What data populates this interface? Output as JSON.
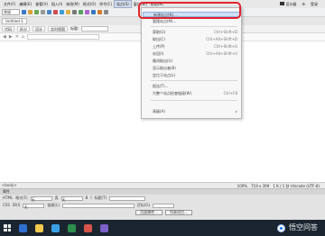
{
  "menubar": {
    "items": [
      "文件(F)",
      "编辑(E)",
      "查看(V)",
      "插入(I)",
      "修改(M)",
      "格式(O)",
      "命令(C)",
      "站点(S)",
      "窗口(W)",
      "帮助(H)"
    ],
    "right": [
      "设计器",
      "⚙",
      "登录"
    ]
  },
  "toolbar": {
    "style_select": "常规"
  },
  "document": {
    "tab": "Untitled-1"
  },
  "viewbar": {
    "buttons": [
      "代码",
      "拆分",
      "设计",
      "实时视图"
    ],
    "title_label": "标题:"
  },
  "site_menu": {
    "items": [
      {
        "label": "新建站点(N)...",
        "shortcut": ""
      },
      {
        "label": "管理站点(M)...",
        "shortcut": ""
      },
      {
        "label": "获取(G)",
        "shortcut": "Ctrl+Shift+D"
      },
      {
        "label": "取出(C)",
        "shortcut": "Ctrl+Alt+Shift+D"
      },
      {
        "label": "上传(P)",
        "shortcut": "Ctrl+Shift+U"
      },
      {
        "label": "存回(I)",
        "shortcut": "Ctrl+Alt+Shift+U"
      },
      {
        "label": "撤消取出(U)",
        "shortcut": ""
      },
      {
        "label": "显示取出者(B)",
        "shortcut": ""
      },
      {
        "label": "定位于站点(L)",
        "shortcut": ""
      },
      {
        "label": "报告(T)...",
        "shortcut": ""
      },
      {
        "label": "为整个站点检查链接(W)",
        "shortcut": "Ctrl+F8"
      },
      {
        "label": "高级(A)",
        "shortcut": "▸"
      }
    ]
  },
  "statusbar": {
    "left": "<body>",
    "zoom": "100%",
    "size": "719 x 369",
    "encoding": "1 K / 1 秒 Unicode (UTF-8)"
  },
  "properties": {
    "header": "属性",
    "row1": [
      "HTML",
      "格式(F)",
      "无",
      "类",
      "无",
      "B",
      "I",
      "标题(T)"
    ],
    "row2": [
      "CSS",
      "ID(I)",
      "无",
      "链接(L)",
      "目标(G)"
    ],
    "buttons": [
      "页面属性...",
      "列表项目..."
    ]
  },
  "watermark": {
    "text": "悟空问答"
  },
  "colors": {
    "highlight": "#e0252b",
    "taskbar": "#1b2530",
    "menu_hover": "#cfe0f6"
  }
}
